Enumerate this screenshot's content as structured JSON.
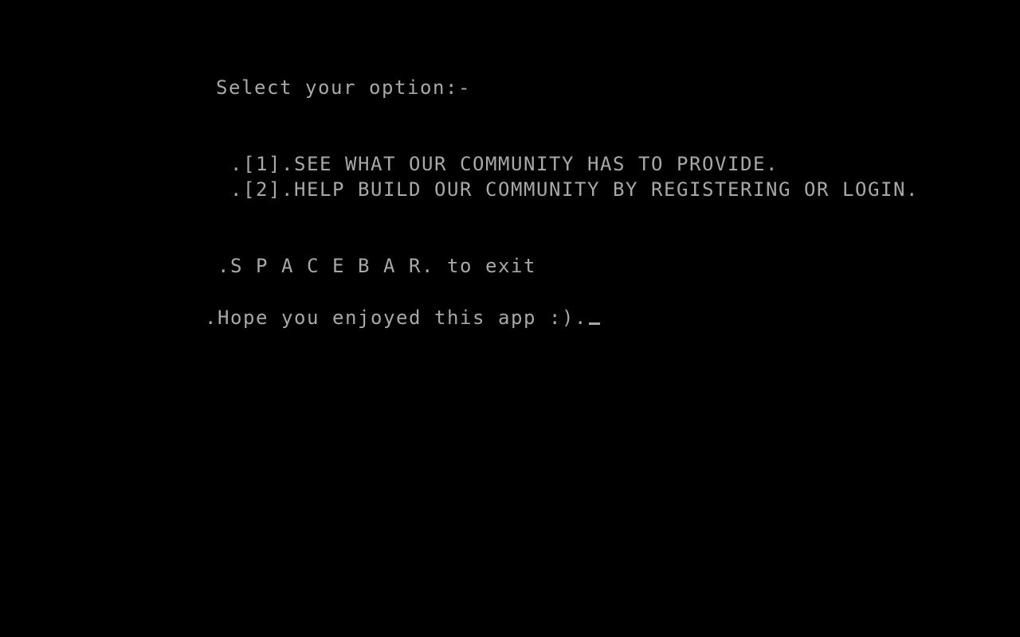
{
  "console": {
    "text_color": "#a8a8a8",
    "background_color": "#000000",
    "prompt": "Select your option:-",
    "options": [
      ".[1].SEE WHAT OUR COMMUNITY HAS TO PROVIDE.",
      ".[2].HELP BUILD OUR COMMUNITY BY REGISTERING OR LOGIN."
    ],
    "exit_hint": ".S P A C E B A R. to exit",
    "farewell": ".Hope you enjoyed this app :).",
    "cursor_glyph": "_"
  }
}
